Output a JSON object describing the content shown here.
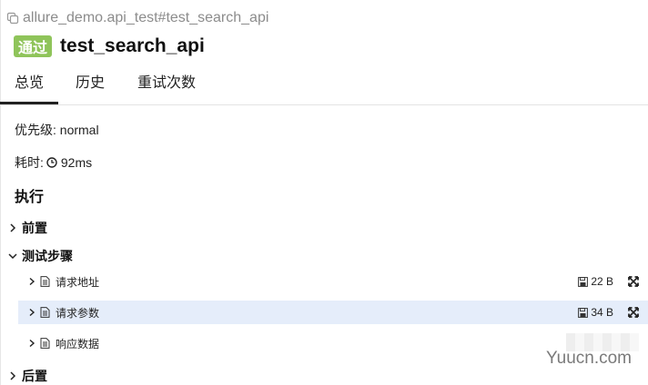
{
  "breadcrumb": "allure_demo.api_test#test_search_api",
  "status": {
    "label": "通过",
    "color": "#8fc45a"
  },
  "title": "test_search_api",
  "tabs": [
    {
      "label": "总览",
      "active": true
    },
    {
      "label": "历史",
      "active": false
    },
    {
      "label": "重试次数",
      "active": false
    }
  ],
  "severity": {
    "label": "优先级:",
    "value": "normal"
  },
  "duration": {
    "label": "耗时:",
    "value": "92ms"
  },
  "execution": {
    "title": "执行",
    "setup": {
      "label": "前置"
    },
    "body": {
      "label": "测试步骤",
      "steps": [
        {
          "label": "请求地址",
          "size": "22 B"
        },
        {
          "label": "请求参数",
          "size": "34 B"
        },
        {
          "label": "响应数据"
        }
      ]
    },
    "teardown": {
      "label": "后置"
    }
  },
  "watermark": "Yuucn.com"
}
